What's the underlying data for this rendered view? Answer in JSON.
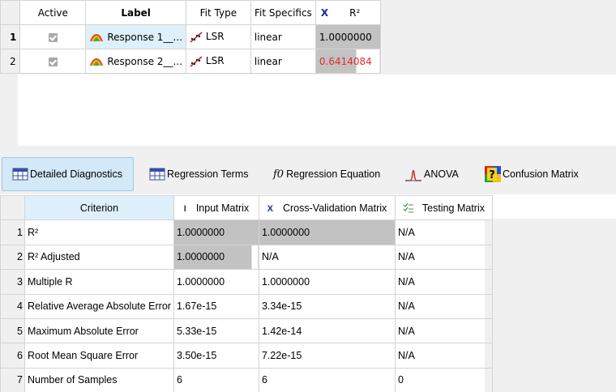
{
  "top_table": {
    "headers": {
      "active": "Active",
      "label": "Label",
      "fit_type": "Fit Type",
      "fit_specifics": "Fit Specifics",
      "r2_icon": "X",
      "r2": "R²"
    },
    "rows": [
      {
        "num": "1",
        "label": "Response 1__...",
        "fit_type": "LSR",
        "fit_specifics": "linear",
        "r2": "1.0000000"
      },
      {
        "num": "2",
        "label": "Response 2__...",
        "fit_type": "LSR",
        "fit_specifics": "linear",
        "r2": "0.6414084"
      }
    ]
  },
  "tabs": {
    "detailed": "Detailed Diagnostics",
    "regression_terms": "Regression Terms",
    "regression_equation_prefix": "f0",
    "regression_equation": "Regression Equation",
    "anova": "ANOVA",
    "confusion": "Confusion Matrix"
  },
  "diag_table": {
    "headers": {
      "criterion": "Criterion",
      "input_icon": "I",
      "input": "Input Matrix",
      "cv_icon": "X",
      "cv": "Cross-Validation Matrix",
      "testing": "Testing Matrix"
    },
    "rows": [
      {
        "num": "1",
        "criterion": "R²",
        "input": "1.0000000",
        "cv": "1.0000000",
        "testing": "N/A"
      },
      {
        "num": "2",
        "criterion": "R² Adjusted",
        "input": "1.0000000",
        "cv": "N/A",
        "testing": "N/A"
      },
      {
        "num": "3",
        "criterion": "Multiple R",
        "input": "1.0000000",
        "cv": "1.0000000",
        "testing": "N/A"
      },
      {
        "num": "4",
        "criterion": "Relative Average Absolute Error",
        "input": "1.67e-15",
        "cv": "3.34e-15",
        "testing": "N/A"
      },
      {
        "num": "5",
        "criterion": "Maximum Absolute Error",
        "input": "5.33e-15",
        "cv": "1.42e-14",
        "testing": "N/A"
      },
      {
        "num": "6",
        "criterion": "Root Mean Square Error",
        "input": "3.50e-15",
        "cv": "7.22e-15",
        "testing": "N/A"
      },
      {
        "num": "7",
        "criterion": "Number of Samples",
        "input": "6",
        "cv": "6",
        "testing": "0"
      }
    ]
  },
  "colors": {
    "selection": "#ddf0fb",
    "grey_cell": "#c2c2c2",
    "red_value": "#e0302c",
    "icon_blue": "#1a2a9a"
  }
}
